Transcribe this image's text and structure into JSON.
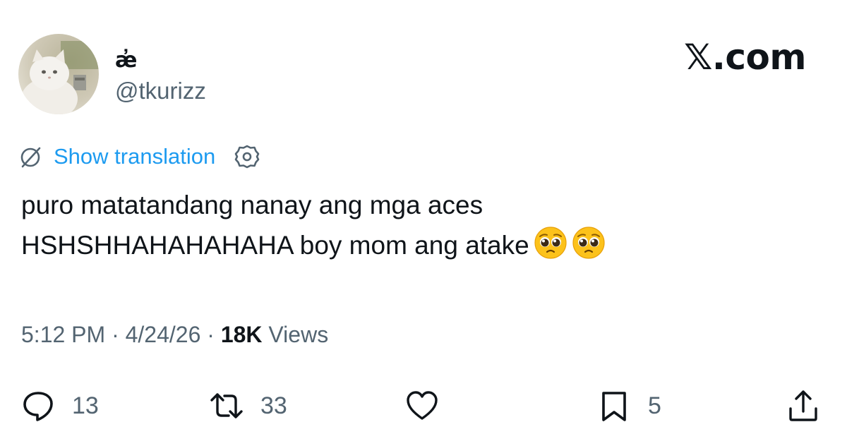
{
  "author": {
    "display_name": "æ̓",
    "handle": "@tkurizz"
  },
  "brand": "𝕏.com",
  "translation": {
    "label": "Show translation"
  },
  "tweet": {
    "text": "puro matatandang nanay ang mga aces\nHSHSHHAHAHAHAHA boy mom ang atake",
    "emojis": [
      "pleading-face-emoji",
      "pleading-face-emoji"
    ]
  },
  "meta": {
    "time": "5:12 PM",
    "separator": " · ",
    "date": "4/24/26",
    "views_count": "18K",
    "views_label": " Views"
  },
  "actions": {
    "replies": "13",
    "reposts": "33",
    "bookmarks": "5"
  },
  "colors": {
    "text": "#0f1419",
    "secondary": "#536471",
    "link": "#1d9bf0"
  }
}
